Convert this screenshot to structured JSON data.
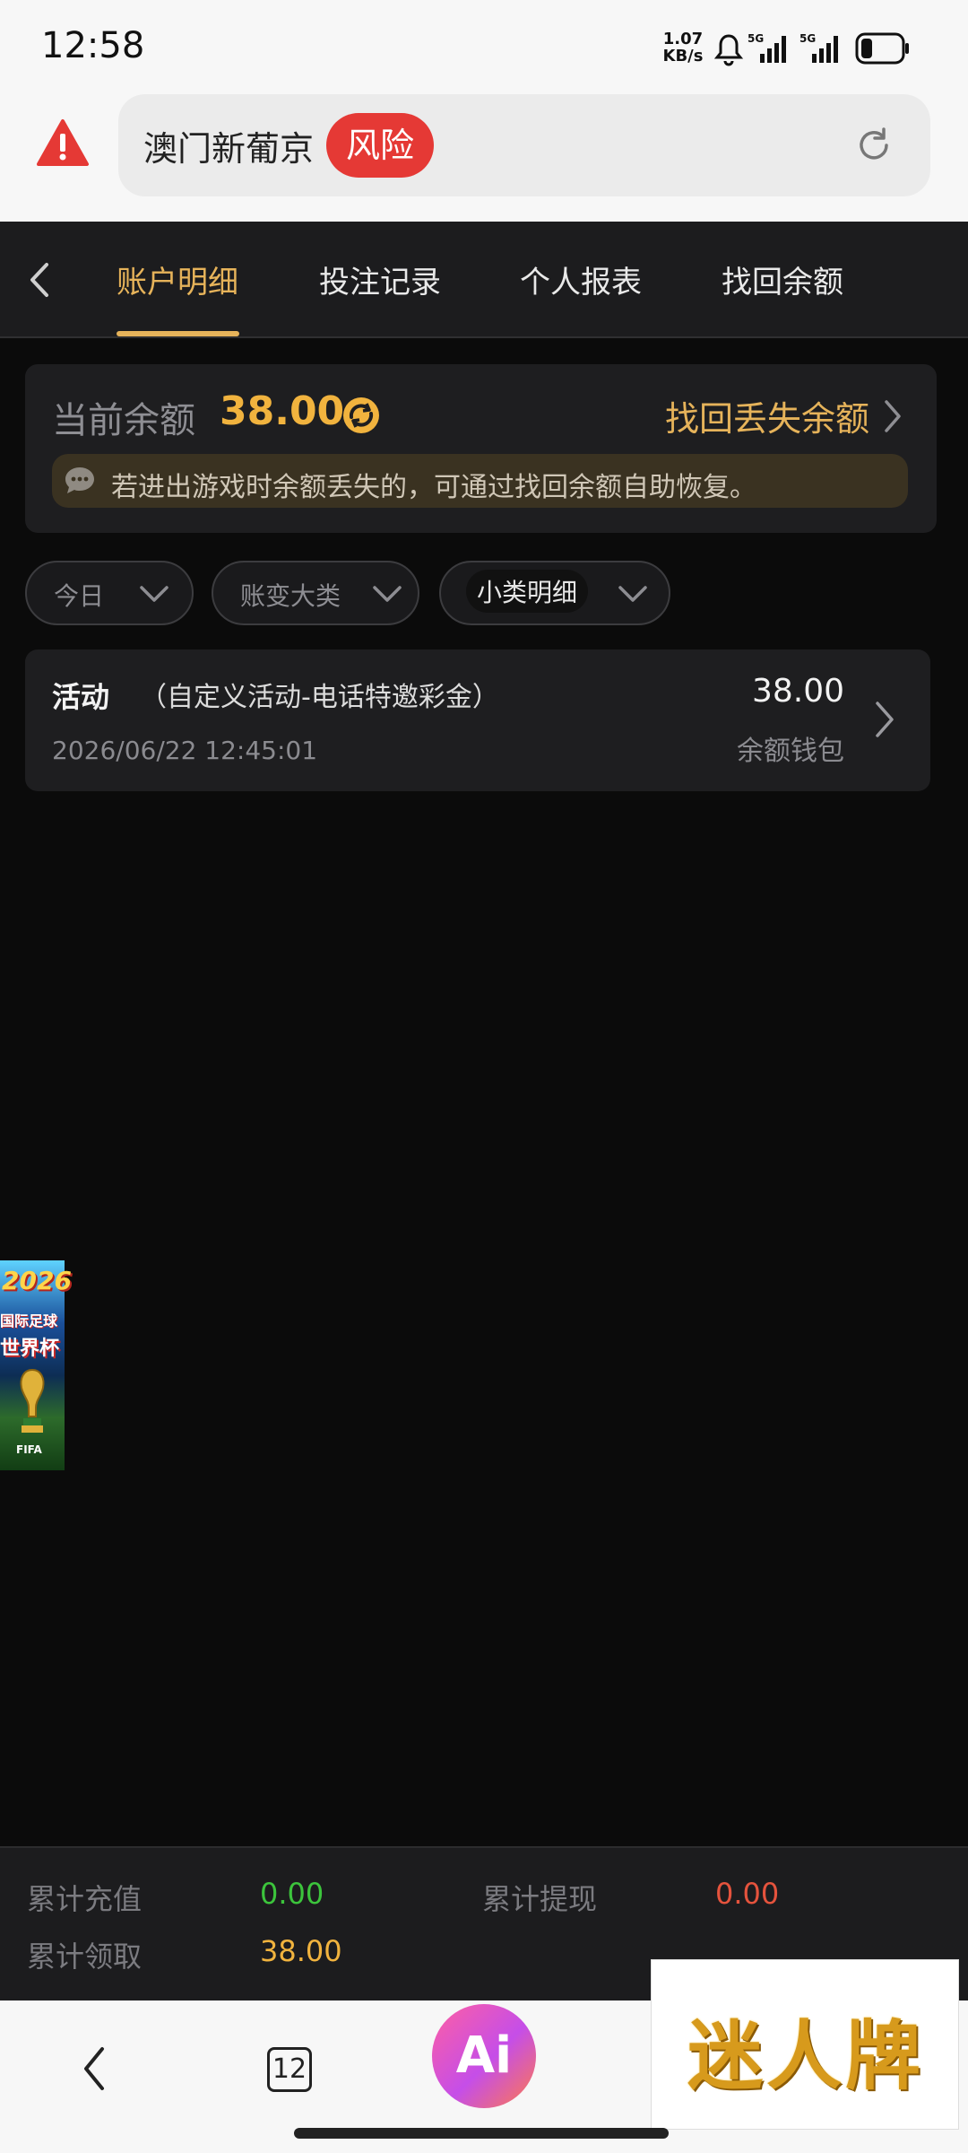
{
  "status_bar": {
    "time": "12:58",
    "net_speed_value": "1.07",
    "net_speed_unit": "KB/s",
    "signal_1_label": "5G",
    "signal_2_label": "5G"
  },
  "browser": {
    "url_title": "澳门新葡京",
    "risk_badge": "风险",
    "tabs_count": "12",
    "ai_label": "Ai"
  },
  "nav": {
    "tabs": [
      {
        "label": "账户明细",
        "active": true
      },
      {
        "label": "投注记录"
      },
      {
        "label": "个人报表"
      },
      {
        "label": "找回余额"
      }
    ]
  },
  "balance": {
    "label": "当前余额",
    "value": "38.00",
    "recover_link": "找回丢失余额",
    "tip": "若进出游戏时余额丢失的，可通过找回余额自助恢复。"
  },
  "filters": {
    "date": "今日",
    "category": "账变大类",
    "subcategory": "小类明细"
  },
  "records": [
    {
      "type": "活动",
      "detail": "（自定义活动-电话特邀彩金）",
      "datetime": "2026/06/22 12:45:01",
      "amount": "38.00",
      "wallet": "余额钱包"
    }
  ],
  "promo": {
    "year": "2026",
    "line1": "国际足球",
    "line2": "世界杯",
    "badge": "FIFA"
  },
  "stats": {
    "recharge_label": "累计充值",
    "recharge_value": "0.00",
    "withdraw_label": "累计提现",
    "withdraw_value": "0.00",
    "claimed_label": "累计领取",
    "claimed_value": "38.00"
  },
  "brand_overlay": {
    "text": "迷人牌"
  },
  "colors": {
    "accent_gold": "#e6b35a",
    "balance_orange": "#f1b33e",
    "risk_red": "#e53935",
    "recharge_green": "#3cc43c",
    "withdraw_red": "#e5533d"
  }
}
